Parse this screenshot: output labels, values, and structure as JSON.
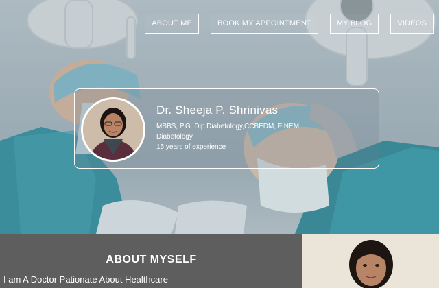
{
  "nav": {
    "items": [
      "ABOUT ME",
      "BOOK MY APPOINTMENT",
      "MY BLOG",
      "VIDEOS"
    ]
  },
  "profile": {
    "name": "Dr. Sheeja P. Shrinivas",
    "qualifications": "MBBS, P.G. Dip.Diabetology,CCBEDM, FINEM",
    "specialty": "Diabetology",
    "experience": "15 years of experience"
  },
  "about": {
    "title": "ABOUT MYSELF",
    "subtitle": "I am A Doctor Pationate About Healthcare"
  },
  "colors": {
    "hero_tint": "#a9b8c0",
    "scrub_teal": "#2f8e9e",
    "section_gray": "#5e5e5e",
    "white": "#ffffff"
  }
}
